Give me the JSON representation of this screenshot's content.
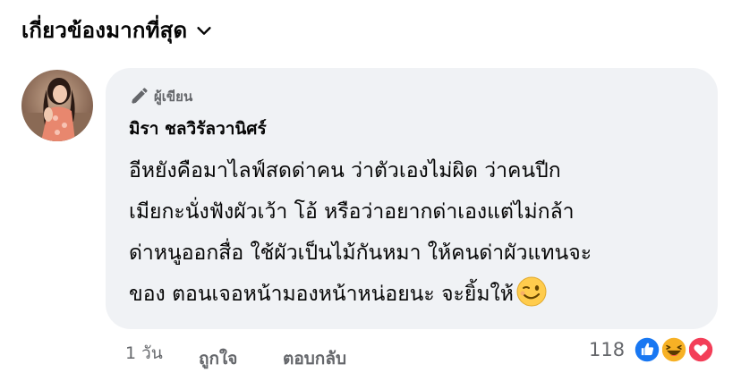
{
  "sort": {
    "label": "เกี่ยวข้องมากที่สุด",
    "icon": "chevron-down-icon"
  },
  "comment": {
    "badge": {
      "label": "ผู้เขียน",
      "icon": "pen-icon"
    },
    "author": "มิรา ชลวิรัลวานิศร์",
    "lines": [
      "อีหยังคือมาไลฟ์สดด่าคน ว่าตัวเองไม่ผิด ว่าคนปีก",
      "เมียกะนั่งฟังผัวเว้า โอ้ หรือว่าอยากด่าเองแต่ไม่กล้า",
      "ด่าหนูออกสื่อ ใช้ผัวเป็นไม้กันหมา ให้คนด่าผัวแทนจะ",
      "ของ ตอนเจอหน้ามองหน้าหน่อยนะ จะยิ้มให้"
    ],
    "emoji": "winking-face-icon"
  },
  "meta": {
    "time": "1 วัน",
    "like_label": "ถูกใจ",
    "reply_label": "ตอบกลับ"
  },
  "reactions": {
    "count": "118",
    "icons": [
      "like-reaction-icon",
      "haha-reaction-icon",
      "love-reaction-icon"
    ],
    "colors": {
      "like": "#1877f2",
      "haha": "#f7b125",
      "love": "#f33e58"
    }
  }
}
